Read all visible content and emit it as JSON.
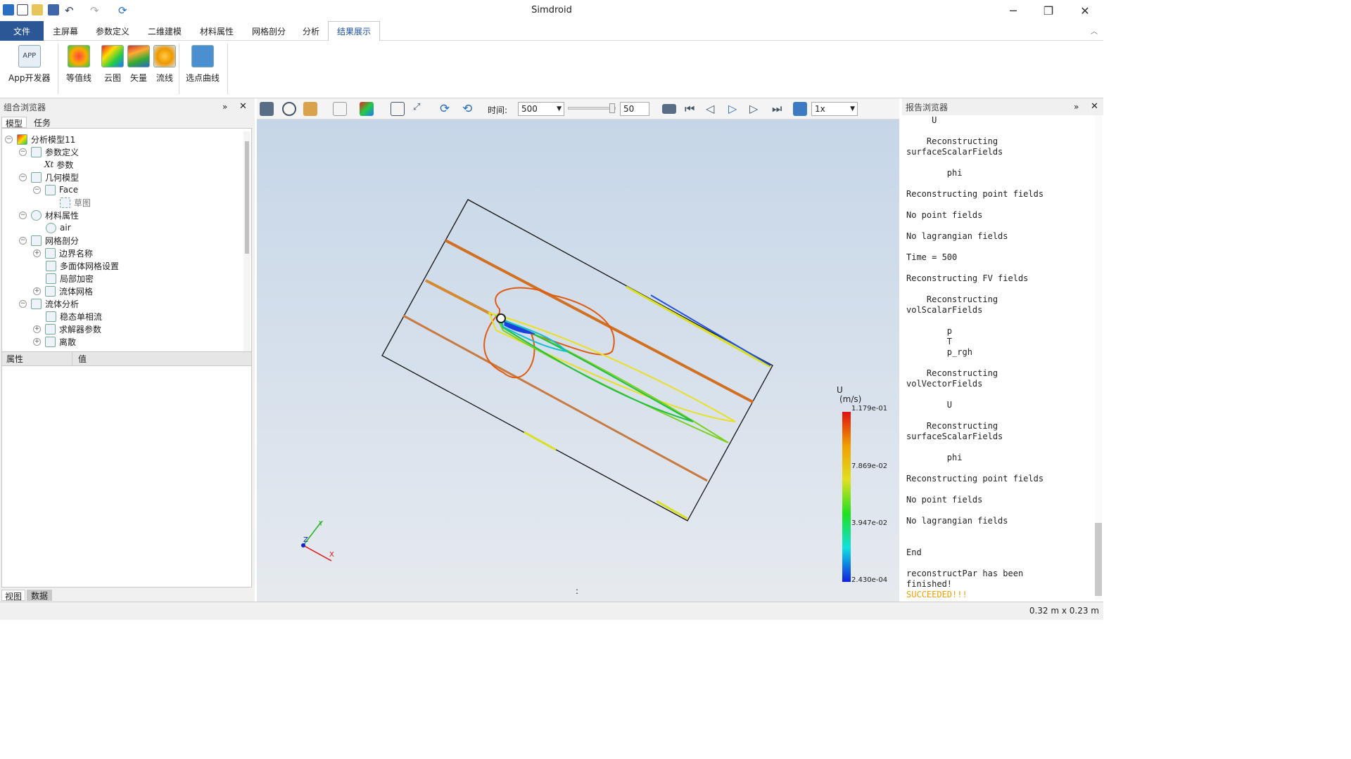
{
  "window": {
    "title": "Simdroid",
    "minimize": "─",
    "restore": "❐",
    "close": "✕"
  },
  "menu": {
    "file": "文件",
    "tabs": [
      "主屏幕",
      "参数定义",
      "二维建模",
      "材料属性",
      "网格剖分",
      "分析",
      "结果展示"
    ]
  },
  "ribbon": {
    "app": "App开发器",
    "contour": "等值线",
    "cloud": "云图",
    "vector": "矢量",
    "streamline": "流线",
    "probe": "选点曲线"
  },
  "left": {
    "title": "组合浏览器",
    "tabs": [
      "模型",
      "任务"
    ],
    "tree": [
      "分析模型11",
      "参数定义",
      "参数",
      "几何模型",
      "Face",
      "草图",
      "材料属性",
      "air",
      "网格剖分",
      "边界名称",
      "多面体网格设置",
      "局部加密",
      "流体网格",
      "流体分析",
      "稳态单相流",
      "求解器参数",
      "离散"
    ],
    "prop_headers": [
      "属性",
      "值"
    ],
    "bottom_tabs": [
      "视图",
      "数据"
    ]
  },
  "toolbar": {
    "time_label": "时间:",
    "time_value": "500",
    "step_value": "50",
    "speed": "1x"
  },
  "legend": {
    "title": "U",
    "unit": "(m/s)",
    "max": "1.179e-01",
    "v2": "7.869e-02",
    "v3": "3.947e-02",
    "min": "2.430e-04"
  },
  "axes": {
    "x": "X",
    "y": "Y",
    "z": "Z"
  },
  "right": {
    "title": "报告浏览器",
    "log": "     U\n\n    Reconstructing\nsurfaceScalarFields\n\n        phi\n\nReconstructing point fields\n\nNo point fields\n\nNo lagrangian fields\n\nTime = 500\n\nReconstructing FV fields\n\n    Reconstructing\nvolScalarFields\n\n        p\n        T\n        p_rgh\n\n    Reconstructing\nvolVectorFields\n\n        U\n\n    Reconstructing\nsurfaceScalarFields\n\n        phi\n\nReconstructing point fields\n\nNo point fields\n\nNo lagrangian fields\n\n\nEnd\n\nreconstructPar has been\nfinished!",
    "status": "SUCCEEDED!!!"
  },
  "status": {
    "size": "0.32 m x 0.23 m",
    "dot": ":"
  },
  "colors": {
    "accent": "#2b5797",
    "success": "#f0a000"
  }
}
